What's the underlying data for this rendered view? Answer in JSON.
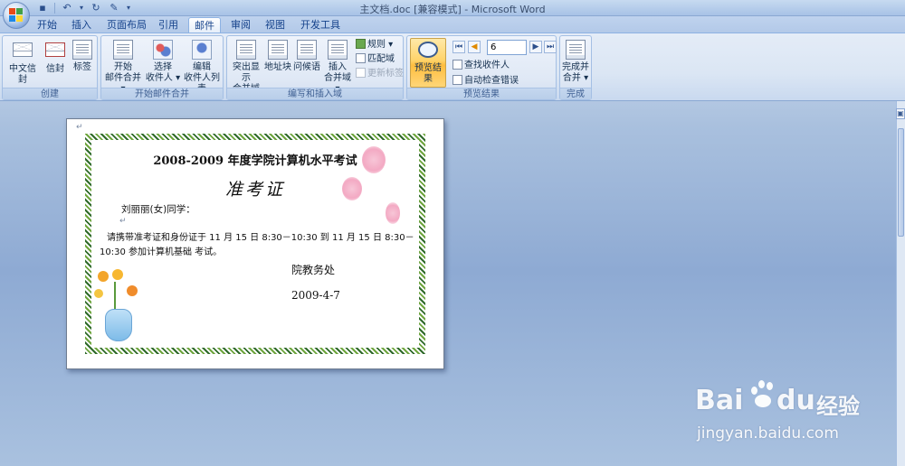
{
  "window": {
    "title": "主文档.doc [兼容模式] - Microsoft Word"
  },
  "tabs": [
    {
      "label": "开始",
      "active": false
    },
    {
      "label": "插入",
      "active": false
    },
    {
      "label": "页面布局",
      "active": false
    },
    {
      "label": "引用",
      "active": false
    },
    {
      "label": "邮件",
      "active": true
    },
    {
      "label": "审阅",
      "active": false
    },
    {
      "label": "视图",
      "active": false
    },
    {
      "label": "开发工具",
      "active": false
    }
  ],
  "ribbon": {
    "groups": {
      "create": {
        "label": "创建",
        "buttons": [
          "中文信封",
          "信封",
          "标签"
        ]
      },
      "start_merge": {
        "label": "开始邮件合并",
        "buttons": [
          {
            "line1": "开始",
            "line2": "邮件合并 ▾"
          },
          {
            "line1": "选择",
            "line2": "收件人 ▾"
          },
          {
            "line1": "编辑",
            "line2": "收件人列表"
          }
        ]
      },
      "write_insert": {
        "label": "编写和插入域",
        "buttons": [
          {
            "line1": "突出显示",
            "line2": "合并域"
          },
          {
            "line1": "地址块",
            "line2": ""
          },
          {
            "line1": "问候语",
            "line2": ""
          },
          {
            "line1": "插入",
            "line2": "合并域 ▾"
          }
        ],
        "small": [
          {
            "label": "规则 ▾",
            "disabled": false
          },
          {
            "label": "匹配域",
            "disabled": false
          },
          {
            "label": "更新标签",
            "disabled": true
          }
        ]
      },
      "preview": {
        "label": "预览结果",
        "preview_button": "预览结果",
        "record_value": "6",
        "small": [
          "查找收件人",
          "自动检查错误"
        ]
      },
      "finish": {
        "label": "完成",
        "button": {
          "line1": "完成并",
          "line2": "合并 ▾"
        }
      }
    }
  },
  "document": {
    "title": "2008-2009 年度学院计算机水平考试",
    "heading": "准考证",
    "greeting": "刘丽丽(女)同学：",
    "body_line1": "请携带准考证和身份证于 11 月 15 日 8:30－10:30  到 11 月 15 日 8:30－",
    "body_line2": "10:30  参加计算机基础  考试。",
    "signature": "院教务处",
    "date": "2009-4-7",
    "paragraph_mark": "↵"
  },
  "watermark": {
    "brand": "Bai",
    "brand_tail": "du",
    "brand_cn": "经验",
    "url": "jingyan.baidu.com"
  }
}
